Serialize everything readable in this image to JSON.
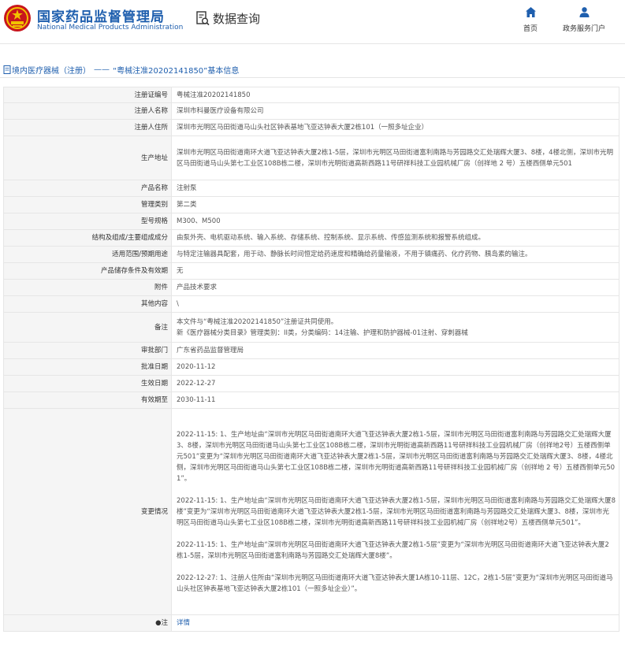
{
  "header": {
    "org_name_cn": "国家药品监督管理局",
    "org_name_en": "National Medical Products Administration",
    "query_label": "数据查询",
    "nav": [
      {
        "label": "首页",
        "icon": "home-icon"
      },
      {
        "label": "政务服务门户",
        "icon": "user-icon"
      }
    ],
    "colors": {
      "brand": "#1f5fae",
      "seal": "#c8161d"
    }
  },
  "breadcrumb": {
    "section": "境内医疗器械（注册）",
    "separator": "——",
    "title": "“粤械注准20202141850”基本信息"
  },
  "details": {
    "rows": [
      {
        "label": "注册证编号",
        "value": "粤械注准20202141850"
      },
      {
        "label": "注册人名称",
        "value": "深圳市科曼医疗设备有限公司"
      },
      {
        "label": "注册人住所",
        "value": "深圳市光明区马田街道马山头社区钟表基地飞亚达钟表大厦2栋101（一照多址企业）"
      },
      {
        "label": "生产地址",
        "value": "深圳市光明区马田街道南环大道飞亚达钟表大厦2栋1-5层，深圳市光明区马田街道富利南路与芳园路交汇处瑞辉大厦3、8楼，4楼北侧，深圳市光明区马田街道马山头第七工业区108B栋二楼，深圳市光明街道高新西路11号研祥科技工业园机械厂房（创祥地 2 号）五楼西侧单元501"
      },
      {
        "label": "产品名称",
        "value": "注射泵"
      },
      {
        "label": "管理类别",
        "value": "第二类"
      },
      {
        "label": "型号规格",
        "value": "M300、M500"
      },
      {
        "label": "结构及组成/主要组成成分",
        "value": "由泵外壳、电机驱动系统、输入系统、存储系统、控制系统、显示系统、传感监测系统和报警系统组成。"
      },
      {
        "label": "适用范围/预期用途",
        "value": "与特定注输器具配套，用于动、静脉长时间恒定给药速度和精确给药量输液，不用于镇痛药、化疗药物、胰岛素的输注。"
      },
      {
        "label": "产品储存条件及有效期",
        "value": "无"
      },
      {
        "label": "附件",
        "value": "产品技术要求"
      },
      {
        "label": "其他内容",
        "value": "\\"
      },
      {
        "label": "备注",
        "lines": [
          "本文件与“粤械注准20202141850”注册证共同使用。",
          "新《医疗器械分类目录》管理类别：II类，分类编码：14注输、护理和防护器械-01注射、穿刺器械"
        ]
      },
      {
        "label": "审批部门",
        "value": "广东省药品监督管理局"
      },
      {
        "label": "批准日期",
        "value": "2020-11-12"
      },
      {
        "label": "生效日期",
        "value": "2022-12-27"
      },
      {
        "label": "有效期至",
        "value": "2030-11-11"
      },
      {
        "label": "变更情况",
        "paragraphs": [
          "2022-11-15: 1、生产地址由“深圳市光明区马田街道南环大道飞亚达钟表大厦2栋1-5层，深圳市光明区马田街道富利南路与芳园路交汇处瑞辉大厦3、8楼，深圳市光明区马田街道马山头第七工业区108B栋二楼，深圳市光明街道高新西路11号研祥科技工业园机械厂房（创祥地2号）五楼西侧单元501”变更为“深圳市光明区马田街道南环大道飞亚达钟表大厦2栋1-5层，深圳市光明区马田街道富利南路与芳园路交汇处瑞辉大厦3、8楼，4楼北侧，深圳市光明区马田街道马山头第七工业区108B栋二楼，深圳市光明街道高新西路11号研祥科技工业园机械厂房（创祥地 2 号）五楼西侧单元501”。",
          "2022-11-15: 1、生产地址由“深圳市光明区马田街道南环大道飞亚达钟表大厦2栋1-5层，深圳市光明区马田街道富利南路与芳园路交汇处瑞辉大厦8楼”变更为“深圳市光明区马田街道南环大道飞亚达钟表大厦2栋1-5层，深圳市光明区马田街道富利南路与芳园路交汇处瑞辉大厦3、8楼，深圳市光明区马田街道马山头第七工业区108B栋二楼，深圳市光明街道高新西路11号研祥科技工业园机械厂房（创祥地2号）五楼西侧单元501”。",
          "2022-11-15: 1、生产地址由“深圳市光明区马田街道南环大道飞亚达钟表大厦2栋1-5层”变更为“深圳市光明区马田街道南环大道飞亚达钟表大厦2栋1-5层，深圳市光明区马田街道富利南路与芳园路交汇处瑞辉大厦8楼”。",
          "2022-12-27: 1、注册人住所由“深圳市光明区马田街道南环大道飞亚达钟表大厦1A栋10-11层、12C，2栋1-5层”变更为“深圳市光明区马田街道马山头社区钟表基地飞亚达钟表大厦2栋101（一照多址企业）”。"
        ]
      },
      {
        "label": "●注",
        "link": "详情"
      }
    ]
  }
}
